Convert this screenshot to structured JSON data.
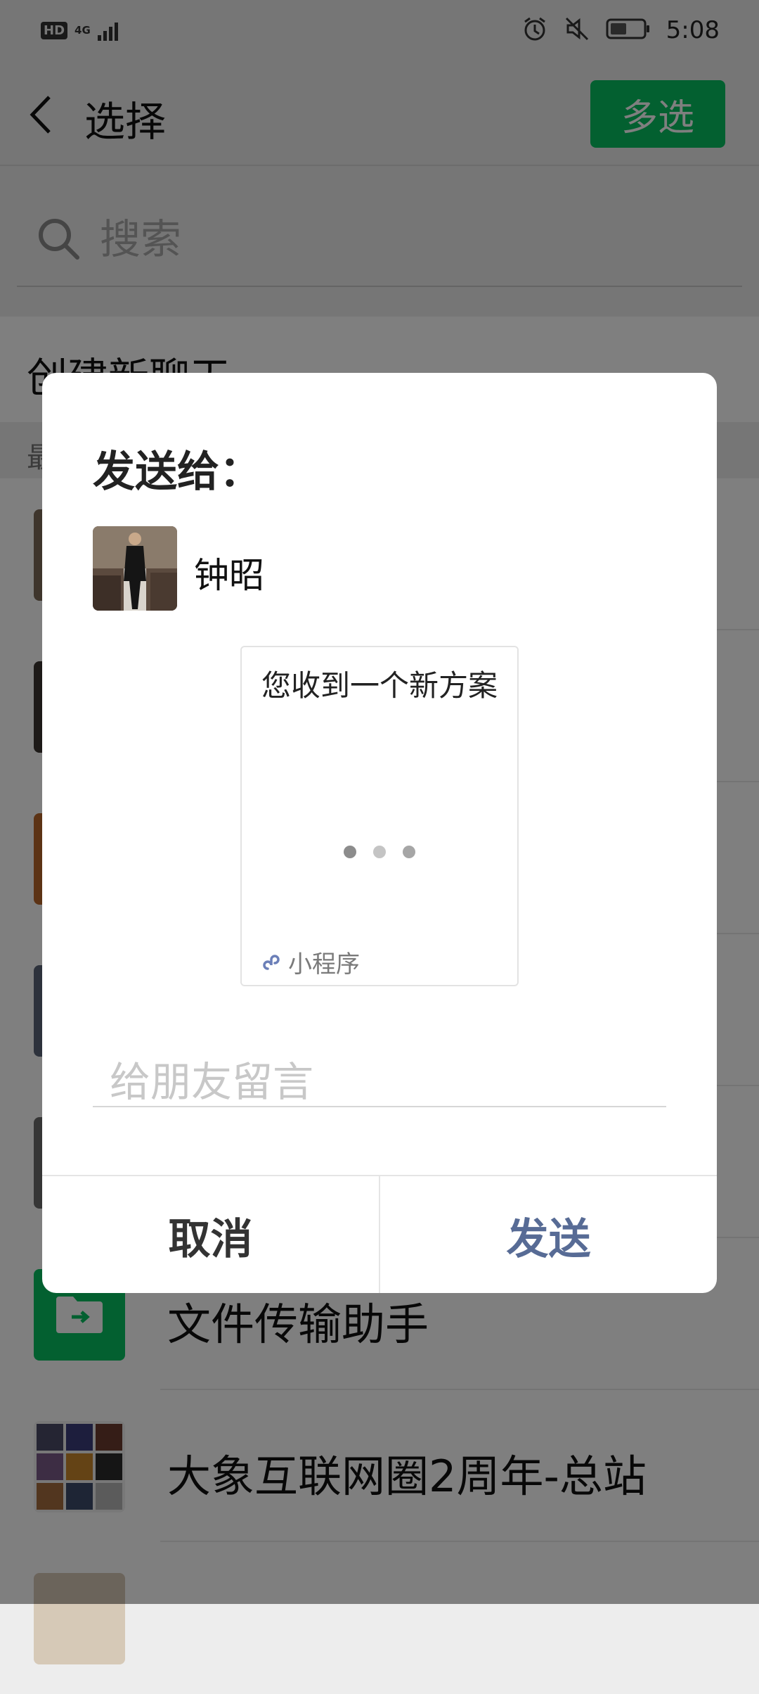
{
  "status_bar": {
    "time": "5:08",
    "hd_label": "HD",
    "network_label": "4G"
  },
  "header": {
    "title": "选择",
    "multi_select_label": "多选"
  },
  "search": {
    "placeholder": "搜索"
  },
  "create_chat_label": "创建新聊天",
  "recent_section_label": "最",
  "list": {
    "file_transfer": "文件传输助手",
    "group_elephant": "大象互联网圈2周年-总站"
  },
  "dialog": {
    "title": "发送给：",
    "recipient_name": "钟昭",
    "card_title": "您收到一个新方案",
    "card_source_label": "小程序",
    "message_placeholder": "给朋友留言",
    "cancel_label": "取消",
    "send_label": "发送"
  },
  "colors": {
    "brand_green": "#07c160",
    "send_blue": "#576b95",
    "miniprogram_icon": "#6b7fb8"
  }
}
